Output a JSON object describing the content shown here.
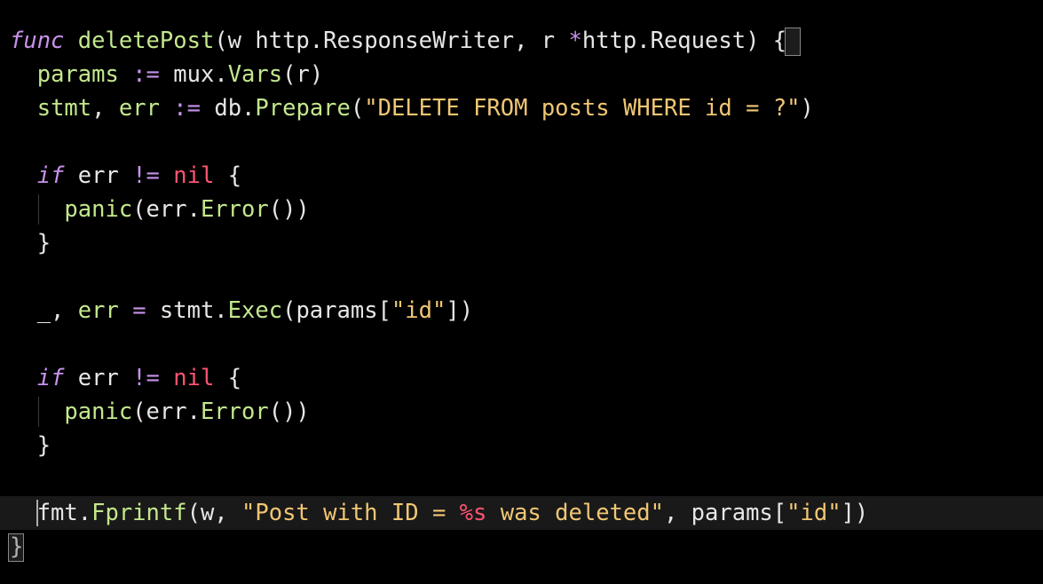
{
  "colors": {
    "background": "#000000",
    "keyword": "#c792ea",
    "function": "#c3e88d",
    "string": "#f0c674",
    "nil": "#ff5370",
    "plain": "#e6e6e6",
    "current_line": "#191919"
  },
  "code": {
    "lines": [
      {
        "tokens": [
          {
            "text": "func",
            "type": "kw-italic"
          },
          {
            "text": " ",
            "type": "plain"
          },
          {
            "text": "deletePost",
            "type": "fn"
          },
          {
            "text": "(w http.ResponseWriter, r ",
            "type": "plain"
          },
          {
            "text": "*",
            "type": "op"
          },
          {
            "text": "http.Request) ",
            "type": "plain"
          },
          {
            "text": "{",
            "type": "plain"
          }
        ]
      },
      {
        "tokens": [
          {
            "text": "  ",
            "type": "plain"
          },
          {
            "text": "params",
            "type": "ident-green"
          },
          {
            "text": " ",
            "type": "plain"
          },
          {
            "text": ":=",
            "type": "op"
          },
          {
            "text": " mux.",
            "type": "plain"
          },
          {
            "text": "Vars",
            "type": "fn"
          },
          {
            "text": "(r)",
            "type": "plain"
          }
        ]
      },
      {
        "tokens": [
          {
            "text": "  ",
            "type": "plain"
          },
          {
            "text": "stmt",
            "type": "ident-green"
          },
          {
            "text": ", ",
            "type": "plain"
          },
          {
            "text": "err",
            "type": "ident-green"
          },
          {
            "text": " ",
            "type": "plain"
          },
          {
            "text": ":=",
            "type": "op"
          },
          {
            "text": " db.",
            "type": "plain"
          },
          {
            "text": "Prepare",
            "type": "fn"
          },
          {
            "text": "(",
            "type": "plain"
          },
          {
            "text": "\"DELETE FROM posts WHERE id = ?\"",
            "type": "str"
          },
          {
            "text": ")",
            "type": "plain"
          }
        ]
      },
      {
        "tokens": []
      },
      {
        "tokens": [
          {
            "text": "  ",
            "type": "plain"
          },
          {
            "text": "if",
            "type": "kw-italic"
          },
          {
            "text": " err ",
            "type": "plain"
          },
          {
            "text": "!=",
            "type": "op"
          },
          {
            "text": " ",
            "type": "plain"
          },
          {
            "text": "nil",
            "type": "nil"
          },
          {
            "text": " {",
            "type": "plain"
          }
        ]
      },
      {
        "tokens": [
          {
            "text": "    ",
            "type": "plain"
          },
          {
            "text": "panic",
            "type": "fn"
          },
          {
            "text": "(err.",
            "type": "plain"
          },
          {
            "text": "Error",
            "type": "fn"
          },
          {
            "text": "())",
            "type": "plain"
          }
        ]
      },
      {
        "tokens": [
          {
            "text": "  }",
            "type": "plain"
          }
        ]
      },
      {
        "tokens": []
      },
      {
        "tokens": [
          {
            "text": "  _, ",
            "type": "plain"
          },
          {
            "text": "err",
            "type": "ident-green"
          },
          {
            "text": " ",
            "type": "plain"
          },
          {
            "text": "=",
            "type": "op"
          },
          {
            "text": " stmt.",
            "type": "plain"
          },
          {
            "text": "Exec",
            "type": "fn"
          },
          {
            "text": "(params[",
            "type": "plain"
          },
          {
            "text": "\"id\"",
            "type": "str"
          },
          {
            "text": "])",
            "type": "plain"
          }
        ]
      },
      {
        "tokens": []
      },
      {
        "tokens": [
          {
            "text": "  ",
            "type": "plain"
          },
          {
            "text": "if",
            "type": "kw-italic"
          },
          {
            "text": " err ",
            "type": "plain"
          },
          {
            "text": "!=",
            "type": "op"
          },
          {
            "text": " ",
            "type": "plain"
          },
          {
            "text": "nil",
            "type": "nil"
          },
          {
            "text": " {",
            "type": "plain"
          }
        ]
      },
      {
        "tokens": [
          {
            "text": "    ",
            "type": "plain"
          },
          {
            "text": "panic",
            "type": "fn"
          },
          {
            "text": "(err.",
            "type": "plain"
          },
          {
            "text": "Error",
            "type": "fn"
          },
          {
            "text": "())",
            "type": "plain"
          }
        ]
      },
      {
        "tokens": [
          {
            "text": "  }",
            "type": "plain"
          }
        ]
      },
      {
        "tokens": []
      },
      {
        "tokens": [
          {
            "text": "  fmt.",
            "type": "plain"
          },
          {
            "text": "Fprintf",
            "type": "fn"
          },
          {
            "text": "(w, ",
            "type": "plain"
          },
          {
            "text": "\"Post with ID = ",
            "type": "str"
          },
          {
            "text": "%s",
            "type": "fmtverb"
          },
          {
            "text": " was deleted\"",
            "type": "str"
          },
          {
            "text": ", params[",
            "type": "plain"
          },
          {
            "text": "\"id\"",
            "type": "str"
          },
          {
            "text": "])",
            "type": "plain"
          }
        ],
        "current": true
      },
      {
        "tokens": [
          {
            "text": "}",
            "type": "plain"
          }
        ]
      }
    ]
  }
}
